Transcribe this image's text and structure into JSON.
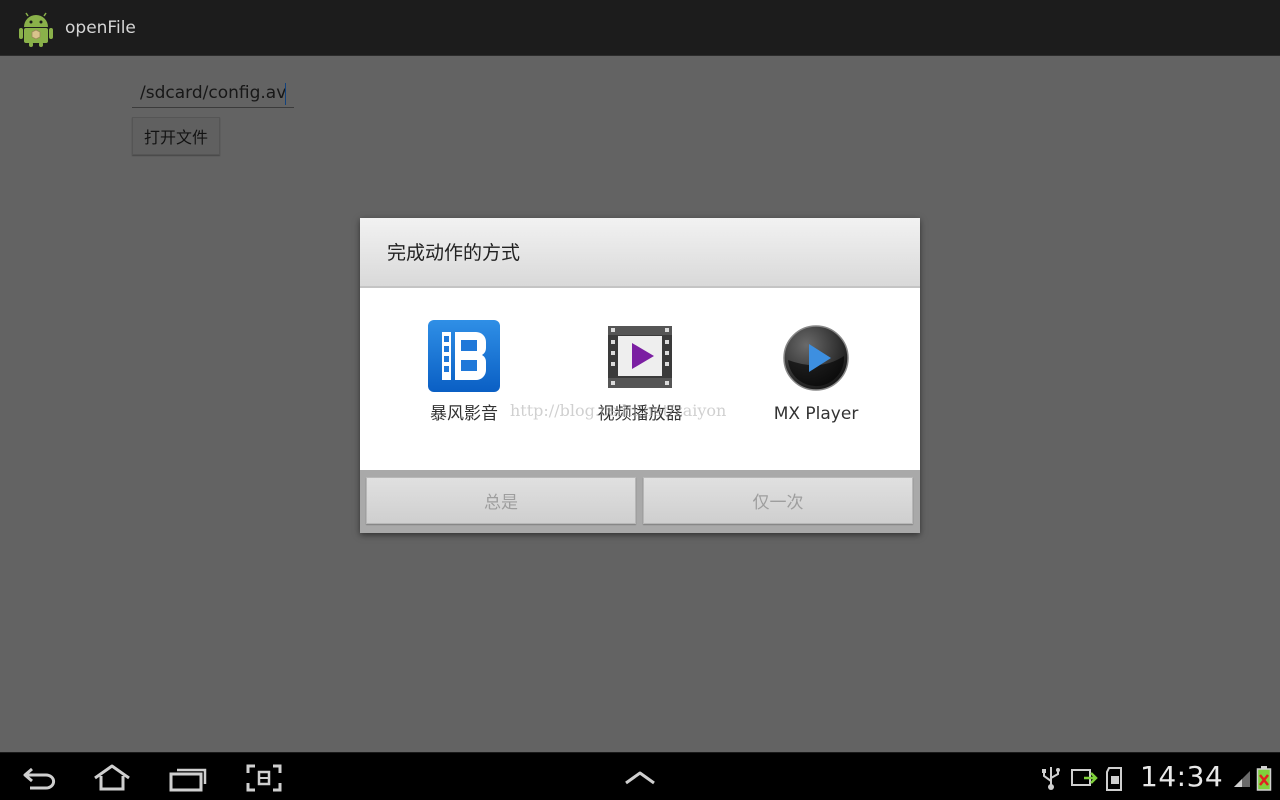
{
  "app": {
    "title": "openFile",
    "icon": "android-robot-icon"
  },
  "main": {
    "path_input_value": "/sdcard/config.avi",
    "open_button_label": "打开文件"
  },
  "dialog": {
    "title": "完成动作的方式",
    "options": [
      {
        "label": "暴风影音",
        "icon": "baofeng-film-icon"
      },
      {
        "label": "视频播放器",
        "icon": "video-player-film-icon"
      },
      {
        "label": "MX Player",
        "icon": "mx-player-play-icon"
      }
    ],
    "watermark": "http://blog.csdn.net/zaiyon",
    "buttons": {
      "always": "总是",
      "just_once": "仅一次"
    }
  },
  "system_bar": {
    "clock": "14:34",
    "nav_icons": [
      "back-icon",
      "home-icon",
      "recent-apps-icon",
      "screenshot-icon",
      "menu-up-icon"
    ],
    "status_icons": [
      "usb-icon",
      "sync-icon",
      "sd-card-icon",
      "signal-icon",
      "battery-icon"
    ]
  },
  "colors": {
    "accent": "#1a5fb4",
    "dialog_header": "#e6e6e6",
    "scrim": "#5f5f5f"
  }
}
